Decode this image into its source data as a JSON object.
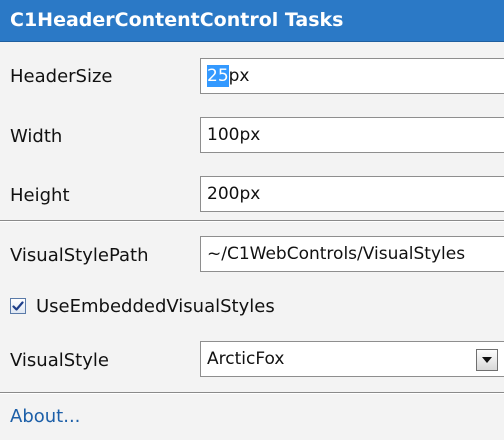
{
  "header": {
    "title": "C1HeaderContentControl Tasks",
    "color": "#2b79c6"
  },
  "fields": [
    {
      "label": "HeaderSize",
      "value": "25px",
      "selected": "25",
      "rest": "px"
    },
    {
      "label": "Width",
      "value": "100px"
    },
    {
      "label": "Height",
      "value": "200px"
    },
    {
      "label": "VisualStylePath",
      "value": "~/C1WebControls/VisualStyles"
    }
  ],
  "checkbox": {
    "label": "UseEmbeddedVisualStyles",
    "checked": true,
    "icon": "checkmark-icon"
  },
  "visual_style": {
    "label": "VisualStyle",
    "value": "ArcticFox",
    "icon": "chevron-down-icon"
  },
  "about": {
    "label": "About...",
    "color": "#1c5fa8"
  }
}
